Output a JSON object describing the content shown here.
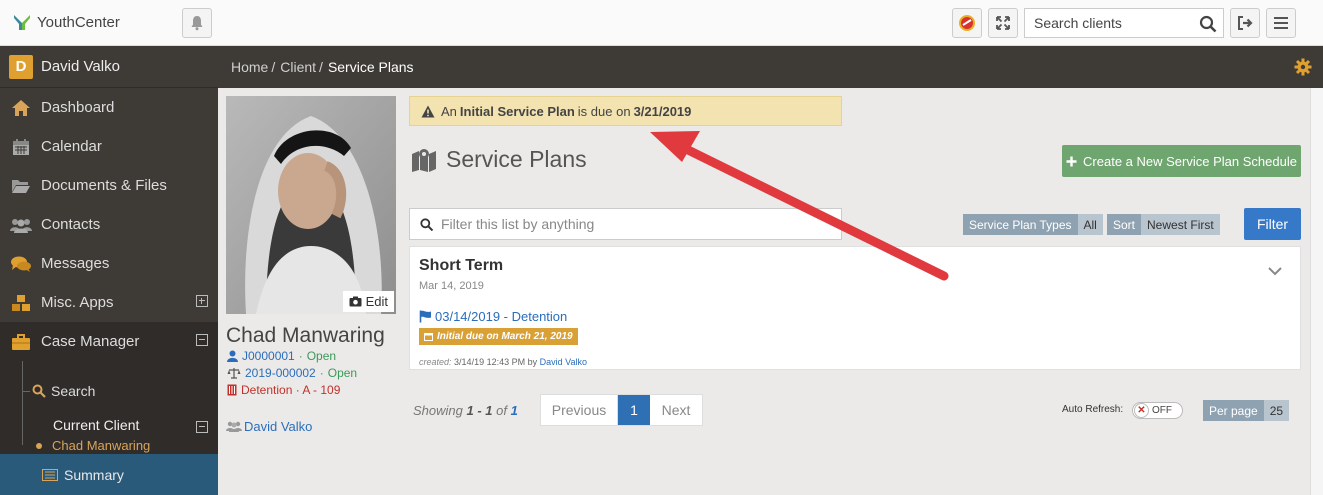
{
  "app": {
    "name": "YouthCenter"
  },
  "header": {
    "search_placeholder": "Search clients"
  },
  "sidebar": {
    "user": {
      "initial": "D",
      "name": "David Valko"
    },
    "items": [
      {
        "label": "Dashboard",
        "icon": "home-icon"
      },
      {
        "label": "Calendar",
        "icon": "calendar-icon"
      },
      {
        "label": "Documents & Files",
        "icon": "folder-icon"
      },
      {
        "label": "Contacts",
        "icon": "contacts-icon"
      },
      {
        "label": "Messages",
        "icon": "comments-icon"
      },
      {
        "label": "Misc. Apps",
        "icon": "cubes-icon"
      },
      {
        "label": "Case Manager",
        "icon": "briefcase-icon"
      }
    ],
    "sub": {
      "search": "Search",
      "current_client": "Current Client",
      "current_client_name": "Chad Manwaring",
      "summary": "Summary"
    }
  },
  "breadcrumb": {
    "items": [
      "Home",
      "Client"
    ],
    "current": "Service Plans"
  },
  "client": {
    "photo_edit": "Edit",
    "name": "Chad Manwaring",
    "juvenile_id": "J0000001",
    "juvenile_status": "Open",
    "case_no": "2019-000002",
    "case_status": "Open",
    "placement": "Detention · A - 109",
    "case_manager": "David Valko"
  },
  "alert": {
    "prefix": "An",
    "bold": "Initial Service Plan",
    "middle": "is due on",
    "date": "3/21/2019"
  },
  "page": {
    "title": "Service Plans",
    "create_button": "Create a New Service Plan Schedule"
  },
  "filters": {
    "placeholder": "Filter this list by anything",
    "types_label": "Service Plan Types",
    "types_value": "All",
    "sort_label": "Sort",
    "sort_value": "Newest First",
    "filter_button": "Filter"
  },
  "plans": [
    {
      "title": "Short Term",
      "date": "Mar 14, 2019",
      "link": "03/14/2019 - Detention",
      "badge": "Initial due on March 21, 2019",
      "created_label": "created:",
      "created_at": "3/14/19 12:43 PM by",
      "created_by": "David Valko"
    }
  ],
  "pagination": {
    "showing_word": "Showing",
    "range": "1 - 1",
    "of_word": "of",
    "total": "1",
    "prev": "Previous",
    "current": "1",
    "next": "Next"
  },
  "auto_refresh": {
    "label": "Auto Refresh:",
    "state": "OFF"
  },
  "per_page": {
    "label": "Per page",
    "value": "25"
  },
  "colors": {
    "accent_blue": "#2f6fb3",
    "create_green": "#6fa66f",
    "alert_bg": "#f3e3b0",
    "arrow_red": "#e0393e",
    "badge_gold": "#d8a035"
  }
}
